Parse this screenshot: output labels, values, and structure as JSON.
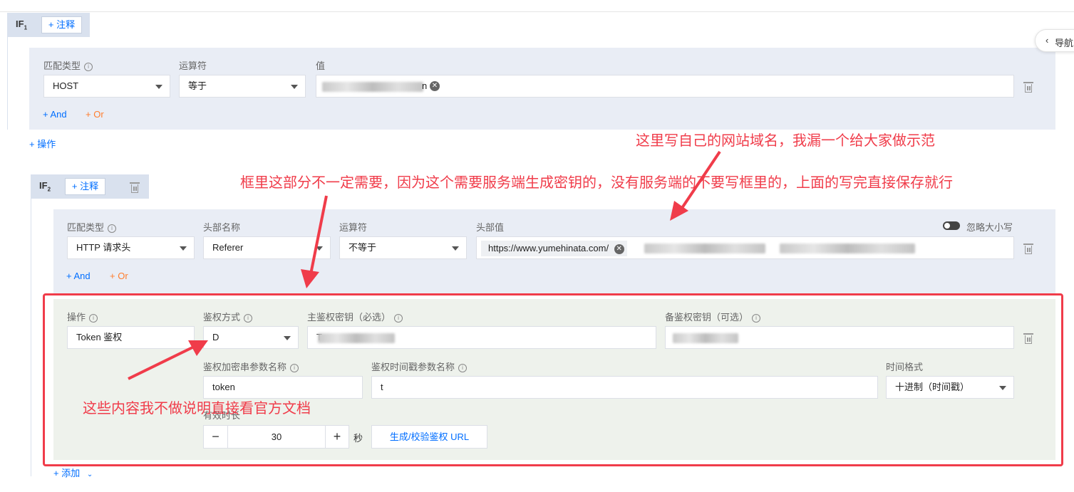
{
  "if1": {
    "badge": "IF",
    "badge_sub": "1",
    "note_button": "+ 注释",
    "labels": {
      "match_type": "匹配类型",
      "operator": "运算符",
      "value": "值"
    },
    "match_type_value": "HOST",
    "operator_value": "等于",
    "value_tag_tail": "n",
    "and_label": "+ And",
    "or_label": "+ Or"
  },
  "add_operation": "+ 操作",
  "nav_toggle": "导航",
  "if2": {
    "badge": "IF",
    "badge_sub": "2",
    "note_button": "+ 注释",
    "labels": {
      "match_type": "匹配类型",
      "header_name": "头部名称",
      "operator": "运算符",
      "header_value": "头部值"
    },
    "ignore_case": "忽略大小写",
    "match_type_value": "HTTP 请求头",
    "header_name_value": "Referer",
    "operator_value": "不等于",
    "header_value_tag": "https://www.yumehinata.com/",
    "and_label": "+ And",
    "or_label": "+ Or",
    "action": {
      "labels": {
        "operation": "操作",
        "auth_method": "鉴权方式",
        "primary_key": "主鉴权密钥（必选）",
        "backup_key": "备鉴权密钥（可选）",
        "sign_param": "鉴权加密串参数名称",
        "timestamp_param": "鉴权时间戳参数名称",
        "time_format": "时间格式",
        "valid_duration": "有效时长"
      },
      "operation_value": "Token 鉴权",
      "auth_method_value": "D",
      "primary_key_prefix": "T",
      "sign_param_value": "token",
      "timestamp_param_value": "t",
      "time_format_value": "十进制（时间戳）",
      "duration_minus": "−",
      "duration_value": "30",
      "duration_plus": "+",
      "duration_unit": "秒",
      "generate_url_button": "生成/校验鉴权 URL"
    },
    "add_label": "+ 添加"
  },
  "annotations": {
    "domain_note": "这里写自己的网站域名，我漏一个给大家做示范",
    "box_note": "框里这部分不一定需要，因为这个需要服务端生成密钥的，没有服务端的不要写框里的，上面的写完直接保存就行",
    "docs_note": "这些内容我不做说明直接看官方文档"
  },
  "colors": {
    "accent": "#006eff",
    "annotation": "#f03c4a",
    "or": "#ff7e2e",
    "panel": "#e9edf5",
    "action_panel": "#eef2ec"
  }
}
